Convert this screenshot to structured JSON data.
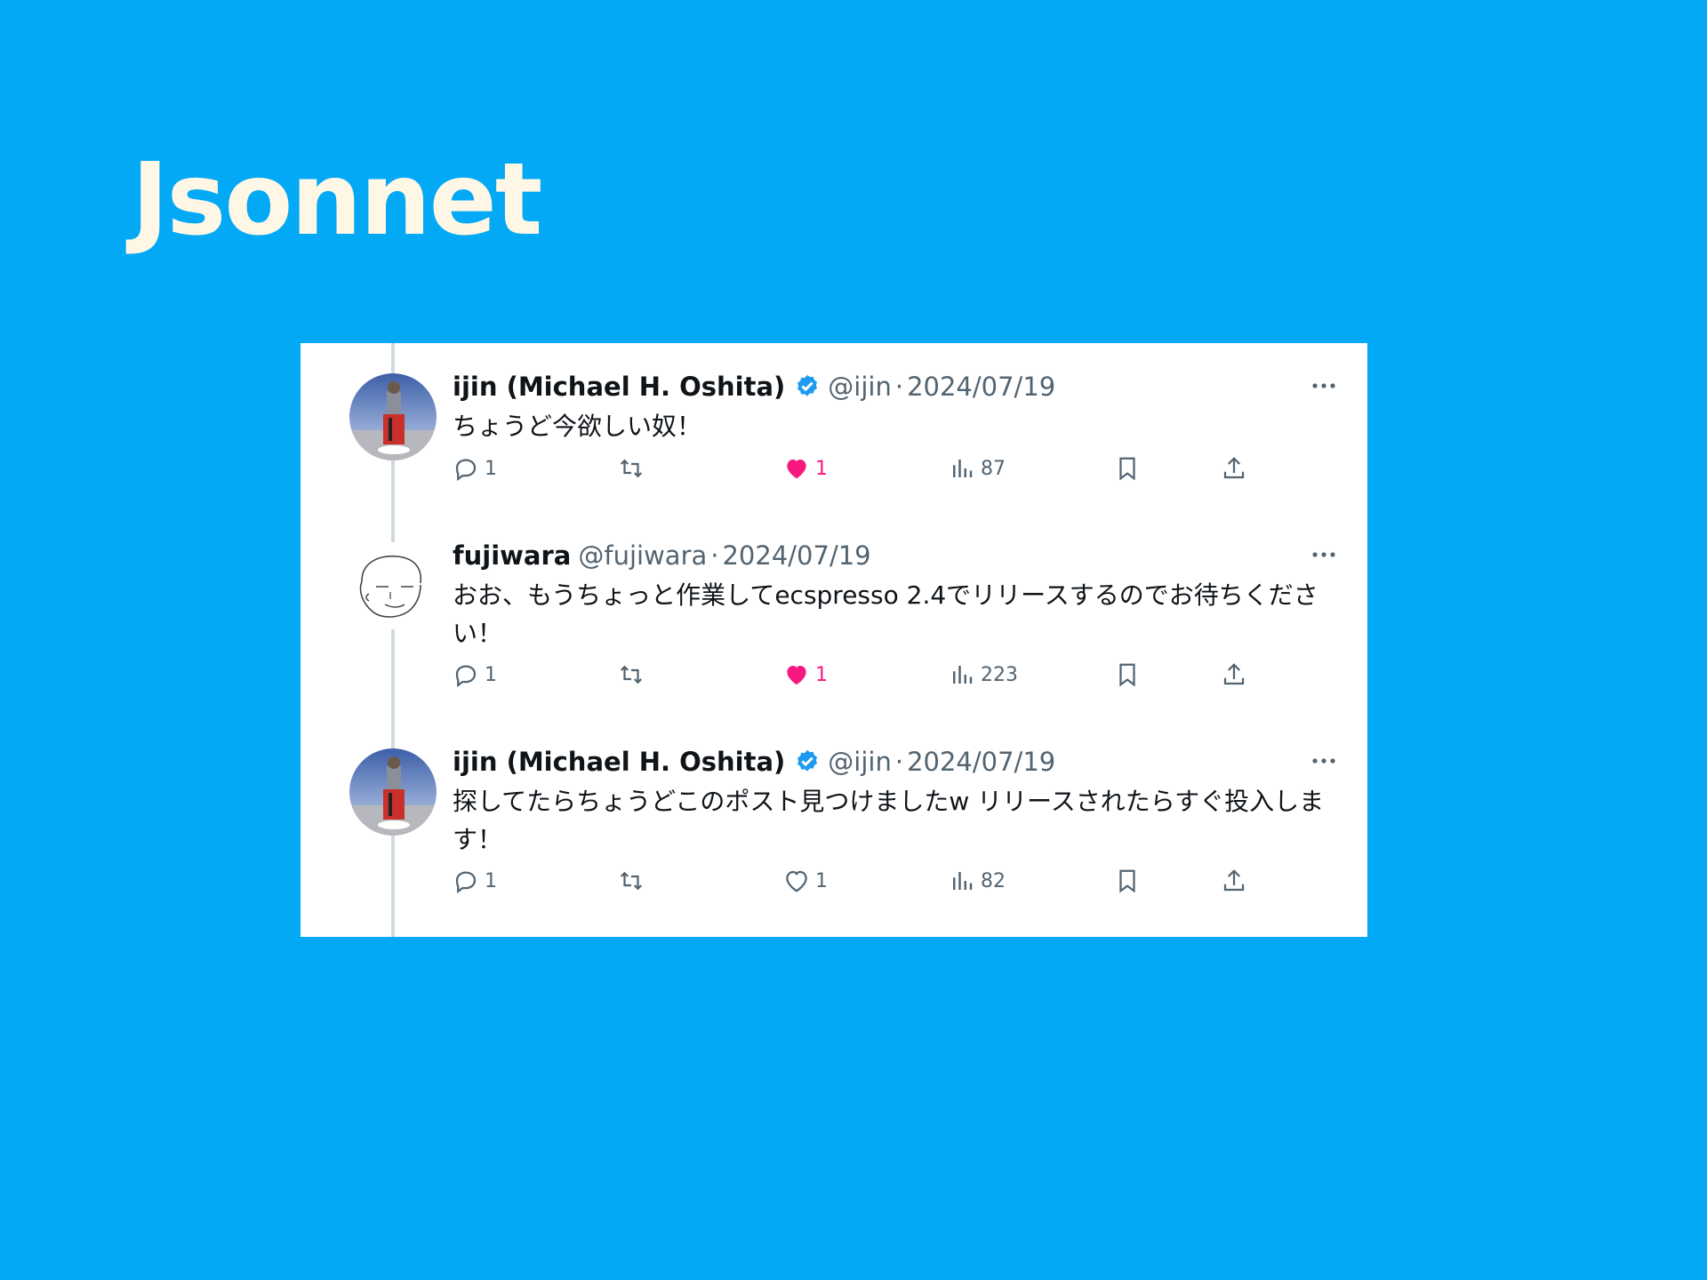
{
  "slide": {
    "title": "Jsonnet"
  },
  "colors": {
    "background": "#03A9F4",
    "title": "#FFF7E6",
    "verified": "#1d9bf0",
    "like": "#f91880",
    "muted": "#536471"
  },
  "tweets": [
    {
      "display_name": "ijin (Michael H. Oshita)",
      "verified": true,
      "handle": "@ijin",
      "separator": "·",
      "date": "2024/07/19",
      "text": "ちょうど今欲しい奴！",
      "replies": "1",
      "retweets": "",
      "likes": "1",
      "liked": true,
      "views": "87",
      "avatar_icon": "user-photo-avatar"
    },
    {
      "display_name": "fujiwara",
      "verified": false,
      "handle": "@fujiwara",
      "separator": "·",
      "date": "2024/07/19",
      "text": "おお、もうちょっと作業してecspresso 2.4でリリースするのでお待ちください！",
      "replies": "1",
      "retweets": "",
      "likes": "1",
      "liked": true,
      "views": "223",
      "avatar_icon": "sketch-face-avatar"
    },
    {
      "display_name": "ijin (Michael H. Oshita)",
      "verified": true,
      "handle": "@ijin",
      "separator": "·",
      "date": "2024/07/19",
      "text": "探してたらちょうどこのポスト見つけましたw リリースされたらすぐ投入します！",
      "replies": "1",
      "retweets": "",
      "likes": "1",
      "liked": false,
      "views": "82",
      "avatar_icon": "user-photo-avatar"
    }
  ]
}
